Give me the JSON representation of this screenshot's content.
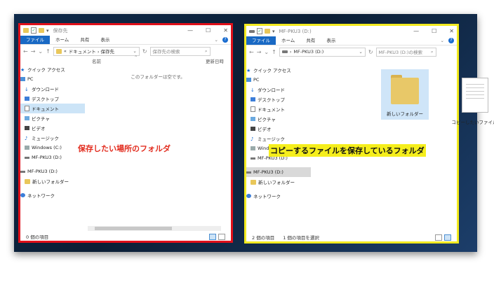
{
  "left_window": {
    "title": "保存先",
    "ribbon_tabs": [
      "ファイル",
      "ホーム",
      "共有",
      "表示"
    ],
    "address": "ドキュメント › 保存先",
    "address_prefix": "«",
    "search_placeholder": "保存先の検索",
    "column_name": "名前",
    "column_updated": "更新日時",
    "empty_message": "このフォルダーは空です。",
    "nav": [
      "クイック アクセス",
      "PC",
      "ダウンロード",
      "デスクトップ",
      "ドキュメント",
      "ピクチャ",
      "ビデオ",
      "ミュージック",
      "Windows (C:)",
      "MF-PKU3 (D:)",
      "MF-PKU3 (D:)",
      "新しいフォルダー",
      "ネットワーク"
    ],
    "status": "0 個の項目",
    "annotation": "保存したい場所のフォルダ"
  },
  "right_window": {
    "title": "MF-PKU3 (D:)",
    "ribbon_tabs": [
      "ファイル",
      "ホーム",
      "共有",
      "表示"
    ],
    "address": "MF-PKU3 (D:)",
    "search_placeholder": "MF-PKU3 (D:)の検索",
    "items": [
      "新しいフォルダー",
      "コピーしたいファイル"
    ],
    "nav": [
      "クイック アクセス",
      "PC",
      "ダウンロード",
      "デスクトップ",
      "ドキュメント",
      "ピクチャ",
      "ビデオ",
      "ミュージック",
      "Windows (C:)",
      "MF-PKU3 (D:)",
      "MF-PKU3 (D:)",
      "新しいフォルダー",
      "ネットワーク"
    ],
    "status_count": "2 個の項目",
    "status_selected": "1 個の項目を選択",
    "annotation": "コピーするファイルを保存しているフォルダ"
  },
  "colors": {
    "left_border": "#e0101a",
    "right_border": "#f2ea20",
    "accent": "#1969c4"
  }
}
